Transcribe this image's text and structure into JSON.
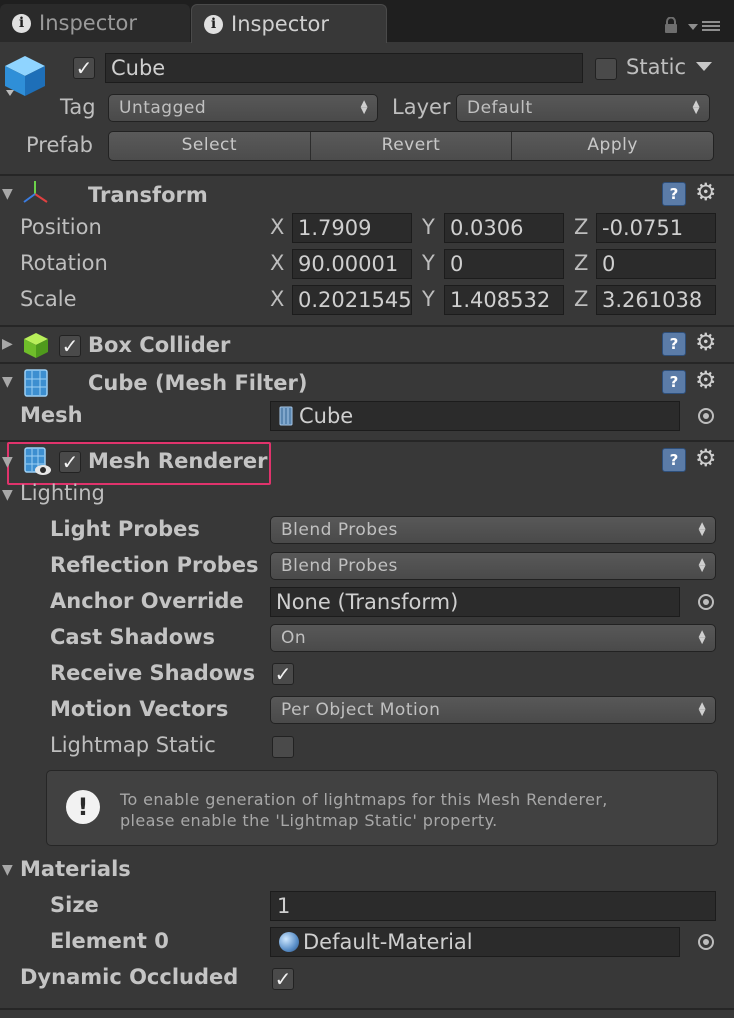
{
  "tabs": [
    {
      "label": "Inspector",
      "active": false
    },
    {
      "label": "Inspector",
      "active": true
    }
  ],
  "header": {
    "object_name": "Cube",
    "active": true,
    "static_label": "Static",
    "static_checked": false,
    "tag_label": "Tag",
    "tag_value": "Untagged",
    "layer_label": "Layer",
    "layer_value": "Default",
    "prefab_label": "Prefab",
    "prefab_buttons": [
      "Select",
      "Revert",
      "Apply"
    ]
  },
  "transform": {
    "title": "Transform",
    "rows": [
      {
        "label": "Position",
        "x": "1.7909",
        "y": "0.0306",
        "z": "-0.0751"
      },
      {
        "label": "Rotation",
        "x": "90.00001",
        "y": "0",
        "z": "0"
      },
      {
        "label": "Scale",
        "x": "0.2021545",
        "y": "1.408532",
        "z": "3.261038"
      }
    ],
    "axis_labels": [
      "X",
      "Y",
      "Z"
    ]
  },
  "box_collider": {
    "title": "Box Collider",
    "enabled": true
  },
  "mesh_filter": {
    "title": "Cube (Mesh Filter)",
    "mesh_label": "Mesh",
    "mesh_value": "Cube"
  },
  "mesh_renderer": {
    "title": "Mesh Renderer",
    "enabled": true,
    "lighting_label": "Lighting",
    "light_probes_label": "Light Probes",
    "light_probes_value": "Blend Probes",
    "reflection_probes_label": "Reflection Probes",
    "reflection_probes_value": "Blend Probes",
    "anchor_override_label": "Anchor Override",
    "anchor_override_value": "None (Transform)",
    "cast_shadows_label": "Cast Shadows",
    "cast_shadows_value": "On",
    "receive_shadows_label": "Receive Shadows",
    "receive_shadows_checked": true,
    "motion_vectors_label": "Motion Vectors",
    "motion_vectors_value": "Per Object Motion",
    "lightmap_static_label": "Lightmap Static",
    "lightmap_static_checked": false,
    "help_line1": "To enable generation of lightmaps for this Mesh Renderer,",
    "help_line2": "please enable the 'Lightmap Static' property.",
    "materials_label": "Materials",
    "size_label": "Size",
    "size_value": "1",
    "element0_label": "Element 0",
    "element0_value": "Default-Material",
    "dynamic_occluded_label": "Dynamic Occluded",
    "dynamic_occluded_checked": true
  },
  "colors": {
    "background": "#383838",
    "highlight_border": "#e0336c",
    "help_icon": "#5b7ca8"
  },
  "icons": {
    "tab": "info-icon",
    "lock": "lock-icon",
    "menu": "tab-menu-icon",
    "object": "cube-icon",
    "transform": "transform-axes-icon",
    "collider": "box-collider-icon",
    "mesh_filter": "mesh-filter-icon",
    "mesh_renderer": "mesh-renderer-icon",
    "help": "help-book-icon",
    "settings": "gear-icon",
    "warning": "exclamation-icon",
    "material": "material-sphere-icon"
  }
}
